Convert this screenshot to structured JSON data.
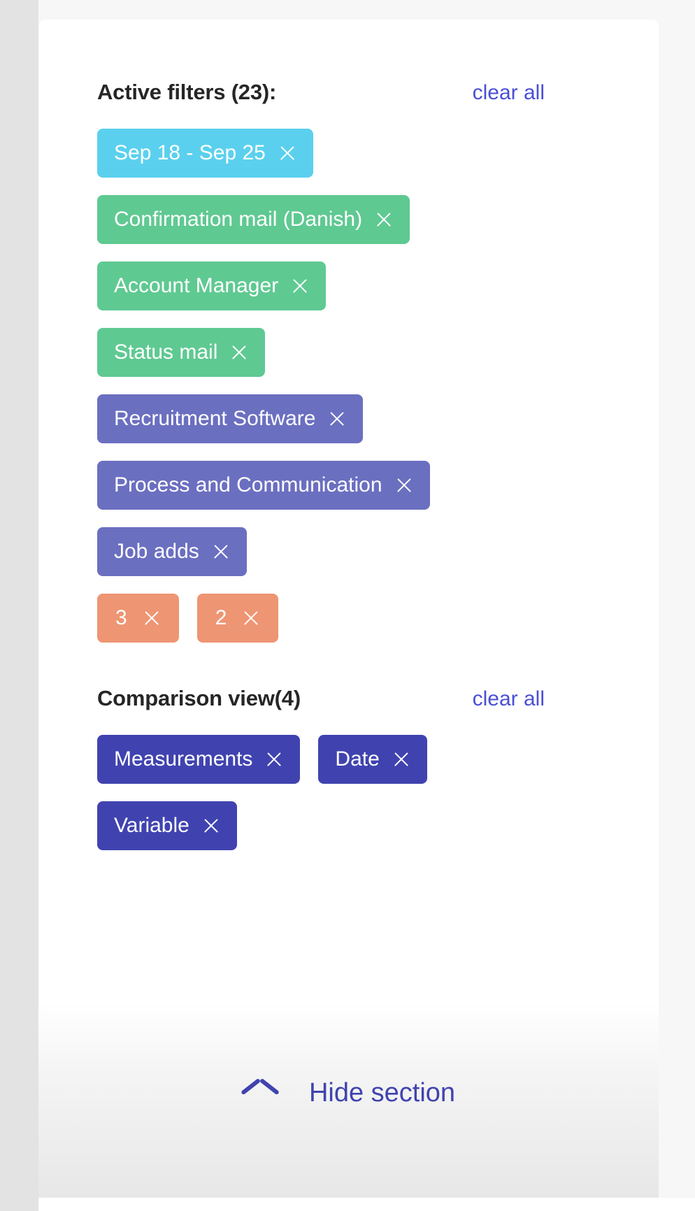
{
  "active_filters": {
    "title": "Active filters (23):",
    "count": 23,
    "clear_all_label": "clear all",
    "rows": [
      [
        {
          "label": "Sep 18 - Sep 25",
          "color": "#5bd0ee",
          "variant": "cyan",
          "remove_icon": "close-icon"
        }
      ],
      [
        {
          "label": "Confirmation mail (Danish)",
          "color": "#5fc992",
          "variant": "green",
          "remove_icon": "close-icon"
        }
      ],
      [
        {
          "label": "Account Manager",
          "color": "#5fc992",
          "variant": "green",
          "remove_icon": "close-icon"
        }
      ],
      [
        {
          "label": "Status mail",
          "color": "#5fc992",
          "variant": "green",
          "remove_icon": "close-icon"
        }
      ],
      [
        {
          "label": "Recruitment Software",
          "color": "#6b6fc0",
          "variant": "purple",
          "remove_icon": "close-icon"
        }
      ],
      [
        {
          "label": "Process and Communication",
          "color": "#6b6fc0",
          "variant": "purple",
          "remove_icon": "close-icon"
        }
      ],
      [
        {
          "label": "Job adds",
          "color": "#6b6fc0",
          "variant": "purple",
          "remove_icon": "close-icon"
        }
      ],
      [
        {
          "label": "3",
          "color": "#ee9573",
          "variant": "orange",
          "remove_icon": "close-icon"
        },
        {
          "label": "2",
          "color": "#ee9573",
          "variant": "orange",
          "remove_icon": "close-icon"
        }
      ]
    ]
  },
  "comparison_view": {
    "title": "Comparison view(4)",
    "count": 4,
    "clear_all_label": "clear all",
    "rows": [
      [
        {
          "label": "Measurements",
          "color": "#4043af",
          "variant": "indigo",
          "remove_icon": "close-icon"
        },
        {
          "label": "Date",
          "color": "#4043af",
          "variant": "indigo",
          "remove_icon": "close-icon"
        }
      ],
      [
        {
          "label": "Variable",
          "color": "#4043af",
          "variant": "indigo",
          "remove_icon": "close-icon"
        }
      ]
    ]
  },
  "footer": {
    "hide_label": "Hide section",
    "chevron_icon": "chevron-up-icon"
  },
  "theme": {
    "link_color": "#4a4fd6",
    "accent_indigo": "#4043af",
    "card_bg": "#ffffff",
    "page_bg": "#f7f7f7",
    "rail_bg": "#e3e3e3",
    "title_color": "#262626"
  }
}
